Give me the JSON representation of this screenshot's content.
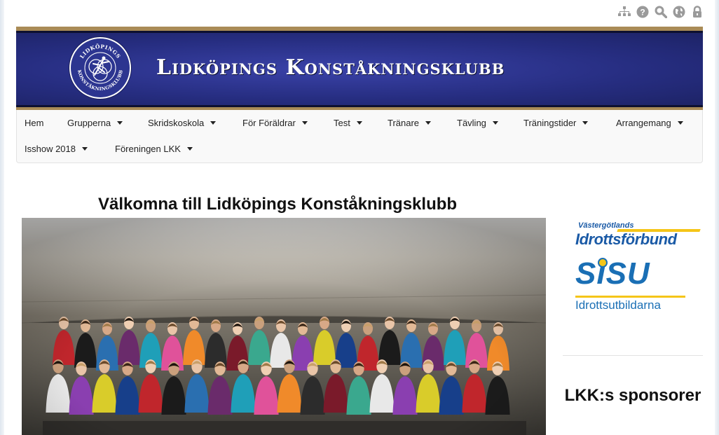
{
  "utility_icons": [
    "sitemap-icon",
    "help-icon",
    "search-icon",
    "globe-icon",
    "lock-icon"
  ],
  "banner": {
    "title": "Lidköpings Konståkningsklubb",
    "logo_text_top": "LIDKÖPINGS",
    "logo_text_bottom": "KONSTÅKNINGSKLUBB"
  },
  "nav": {
    "row1": [
      {
        "label": "Hem",
        "dropdown": false
      },
      {
        "label": "Grupperna",
        "dropdown": true
      },
      {
        "label": "Skridskoskola",
        "dropdown": true
      },
      {
        "label": "För Föräldrar",
        "dropdown": true
      },
      {
        "label": "Test",
        "dropdown": true
      },
      {
        "label": "Tränare",
        "dropdown": true
      },
      {
        "label": "Tävling",
        "dropdown": true
      },
      {
        "label": "Träningstider",
        "dropdown": true
      },
      {
        "label": "Arrangemang",
        "dropdown": true
      }
    ],
    "row2": [
      {
        "label": "Isshow 2018",
        "dropdown": true
      },
      {
        "label": "Föreningen LKK",
        "dropdown": true
      }
    ]
  },
  "main": {
    "title": "Välkomna till Lidköpings Konståkningsklubb"
  },
  "sidebar": {
    "vgif_line1": "Västergötlands",
    "vgif_line2": "Idrottsförbund",
    "sisu_big": "SISU",
    "sisu_sub": "Idrottsutbildarna",
    "sponsor_title": "LKK:s sponsorer"
  },
  "colors": {
    "banner_blue": "#2a318a",
    "banner_gold": "#a98b56",
    "sisu_blue": "#1a6fb5",
    "accent_yellow": "#f5c518"
  }
}
